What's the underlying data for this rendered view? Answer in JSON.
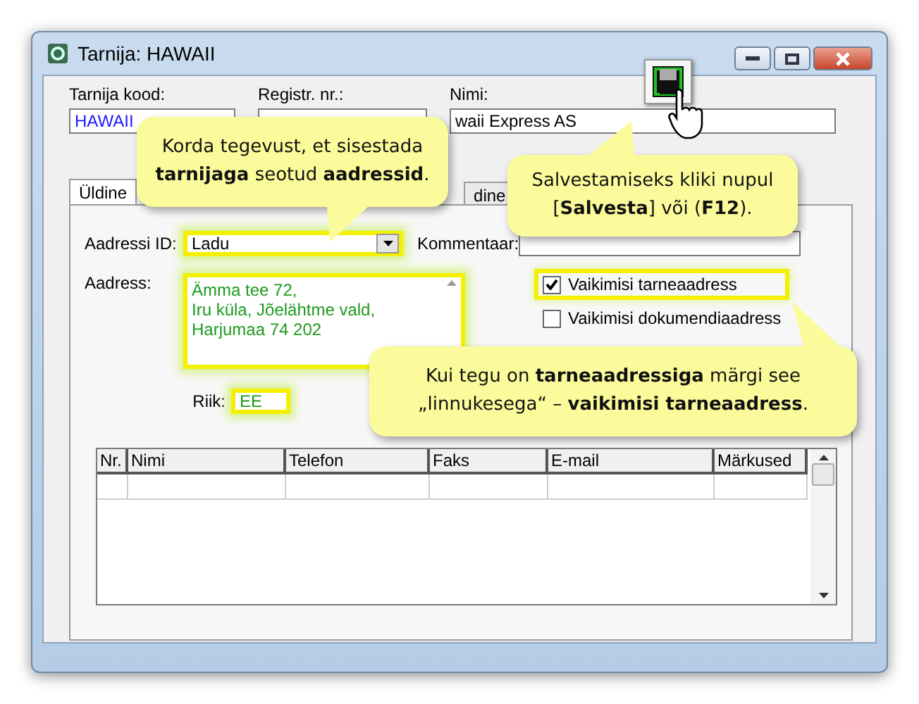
{
  "window": {
    "title": "Tarnija: HAWAII"
  },
  "header_fields": [
    {
      "label": "Tarnija kood:",
      "value": "HAWAII"
    },
    {
      "label": "Registr. nr.:"
    },
    {
      "label": "Nimi:",
      "value": "waii Express AS"
    }
  ],
  "tabs": [
    {
      "label": "Üldine",
      "selected": true
    },
    {
      "label": "dine",
      "selected": false
    }
  ],
  "address_id": {
    "label": "Aadressi ID:",
    "value": "Ladu",
    "highlighted": true
  },
  "comment": {
    "label": "Kommentaar:"
  },
  "address": {
    "label": "Aadress:",
    "lines": [
      "Ämma tee 72,",
      "Iru küla, Jõelähtme vald,",
      "Harjumaa 74 202"
    ],
    "highlighted": true
  },
  "country": {
    "label": "Riik:",
    "value": "EE",
    "highlighted": true
  },
  "checkboxes": [
    {
      "label": "Vaikimisi tarneaadress",
      "checked": true,
      "highlighted": true
    },
    {
      "label": "Vaikimisi dokumendiaadress",
      "checked": false,
      "highlighted": false
    }
  ],
  "table": {
    "columns": [
      "Nr.",
      "Nimi",
      "Telefon",
      "Faks",
      "E-mail",
      "Märkused"
    ]
  },
  "callouts": [
    {
      "text": "Korda tegevust, et sisestada **tarnijaga** seotud **aadressid**."
    },
    {
      "text": "Salvestamiseks kliki nupul [**Salvesta**] või (**F12**)."
    },
    {
      "text": "Kui tegu on **tarneaadressiga** märgi see „linnukesega“ – **vaikimisi tarneaadress**."
    }
  ]
}
